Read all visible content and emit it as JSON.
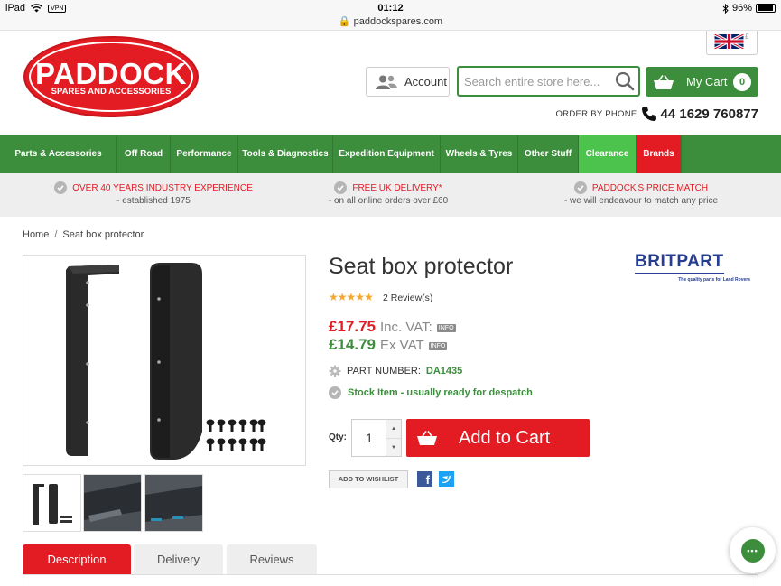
{
  "status_bar": {
    "device": "iPad",
    "vpn": "VPN",
    "time": "01:12",
    "url": "paddockspares.com",
    "battery": "96%",
    "battery_level": 0.96
  },
  "header": {
    "logo_title": "PADDOCK",
    "logo_subtitle": "SPARES AND ACCESSORIES",
    "account_label": "Account",
    "search_placeholder": "Search entire store here...",
    "cart_label": "My Cart",
    "cart_count": "0",
    "order_label": "ORDER BY PHONE",
    "phone": "44 1629 760877"
  },
  "nav": {
    "items": [
      "Parts & Accessories",
      "Off Road",
      "Performance",
      "Tools & Diagnostics",
      "Expedition Equipment",
      "Wheels & Tyres",
      "Other Stuff",
      "Clearance",
      "Brands"
    ]
  },
  "usps": [
    {
      "title": "OVER 40 YEARS INDUSTRY EXPERIENCE",
      "subtitle": "- established 1975"
    },
    {
      "title": "FREE UK DELIVERY*",
      "subtitle": "- on all online orders over £60"
    },
    {
      "title": "PADDOCK'S PRICE MATCH",
      "subtitle": "- we will endeavour to match any price"
    }
  ],
  "breadcrumb": {
    "home": "Home",
    "separator": "/",
    "current": "Seat box protector"
  },
  "product": {
    "title": "Seat box protector",
    "rating": 4.5,
    "reviews": "2 Review(s)",
    "price_inc": "£17.75",
    "price_inc_label": "Inc. VAT:",
    "price_ex": "£14.79",
    "price_ex_label": "Ex VAT",
    "info_badge": "INFO",
    "part_label": "PART NUMBER:",
    "part_number": "DA1435",
    "stock": "Stock Item - usually ready for despatch",
    "qty_label": "Qty:",
    "qty_value": "1",
    "add_to_cart": "Add to Cart",
    "wishlist": "ADD TO WISHLIST"
  },
  "brand": {
    "name": "BRITPART",
    "tagline": "The quality parts for Land Rovers"
  },
  "tabs": [
    "Description",
    "Delivery",
    "Reviews"
  ],
  "colors": {
    "green": "#3c8d3c",
    "red": "#e31b23",
    "clearance_green": "#4cc34c",
    "britpart_blue": "#263d91"
  }
}
